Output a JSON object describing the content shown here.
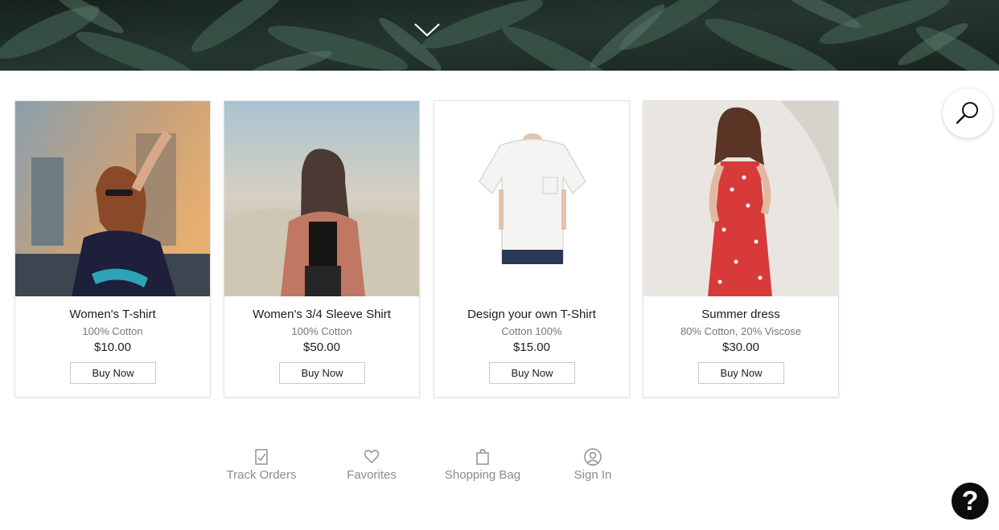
{
  "products": [
    {
      "title": "Women's T-shirt",
      "desc": "100% Cotton",
      "price": "$10.00",
      "cta": "Buy Now"
    },
    {
      "title": "Women's 3/4 Sleeve Shirt",
      "desc": "100% Cotton",
      "price": "$50.00",
      "cta": "Buy Now"
    },
    {
      "title": "Design your own T-Shirt",
      "desc": "Cotton 100%",
      "price": "$15.00",
      "cta": "Buy Now"
    },
    {
      "title": "Summer dress",
      "desc": "80% Cotton, 20% Viscose",
      "price": "$30.00",
      "cta": "Buy Now"
    }
  ],
  "nav": [
    {
      "label": "Track Orders",
      "icon": "clipboard-check-icon"
    },
    {
      "label": "Favorites",
      "icon": "heart-icon"
    },
    {
      "label": "Shopping Bag",
      "icon": "shopping-bag-icon"
    },
    {
      "label": "Sign In",
      "icon": "user-circle-icon"
    }
  ],
  "help": {
    "glyph": "?"
  },
  "colors": {
    "hero_bg": "#1d2b26",
    "accent": "#0c0c0c",
    "nav_text": "#8a8a8a"
  }
}
